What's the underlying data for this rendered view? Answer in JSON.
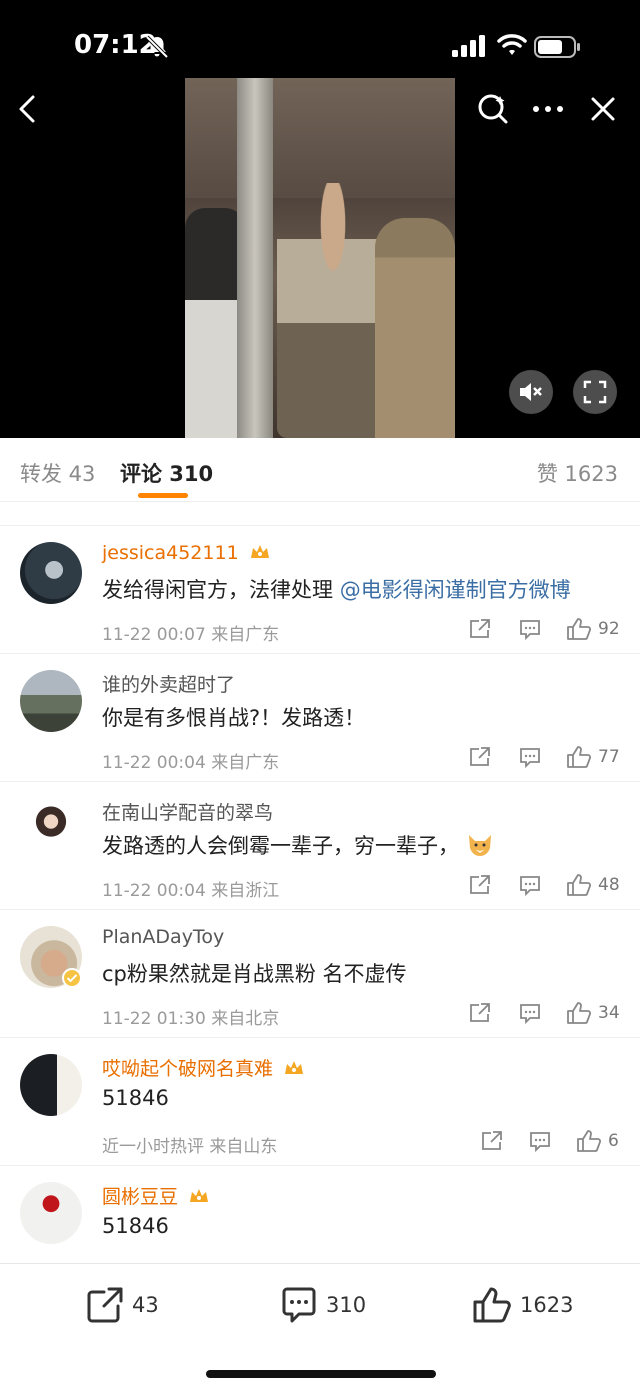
{
  "status_bar": {
    "time": "07:12"
  },
  "tabs": {
    "repost_label": "转发 43",
    "comment_label": "评论 310",
    "like_label": "赞 1623"
  },
  "comments": [
    {
      "username": "jessica452111",
      "content_text": "发给得闲官方，法律处理",
      "mention": "@电影得闲谨制官方微博",
      "meta": "11-22 00:07  来自广东",
      "likes": "92",
      "vip": true
    },
    {
      "username": "谁的外卖超时了",
      "content_text": "你是有多恨肖战?！发路透！",
      "meta": "11-22 00:04  来自广东",
      "likes": "77",
      "vip": false
    },
    {
      "username": "在南山学配音的翠鸟",
      "content_text": "发路透的人会倒霉一辈子，穷一辈子，",
      "meta": "11-22 00:04  来自浙江",
      "likes": "48",
      "vip": false
    },
    {
      "username": "PlanADayToy",
      "content_text": "cp粉果然就是肖战黑粉  名不虚传",
      "meta": "11-22 01:30  来自北京",
      "likes": "34",
      "vip": false
    },
    {
      "username": "哎呦起个破网名真难",
      "content_text": "51846",
      "meta": "近一小时热评  来自山东",
      "likes": "6",
      "vip": true
    },
    {
      "username": "圆彬豆豆",
      "content_text": "51846",
      "meta": "",
      "likes": "",
      "vip": true
    }
  ],
  "bottom_bar": {
    "repost_count": "43",
    "comment_count": "310",
    "like_count": "1623"
  },
  "colors": {
    "accent": "#ff8200",
    "vip_name": "#e96f00",
    "mention": "#3b6ea5"
  },
  "icons": [
    "bell-slash-icon",
    "signal-icon",
    "wifi-icon",
    "battery-icon",
    "back-icon",
    "search-icon",
    "more-icon",
    "close-icon",
    "mute-icon",
    "fullscreen-icon",
    "share-icon",
    "reply-icon",
    "like-icon"
  ]
}
